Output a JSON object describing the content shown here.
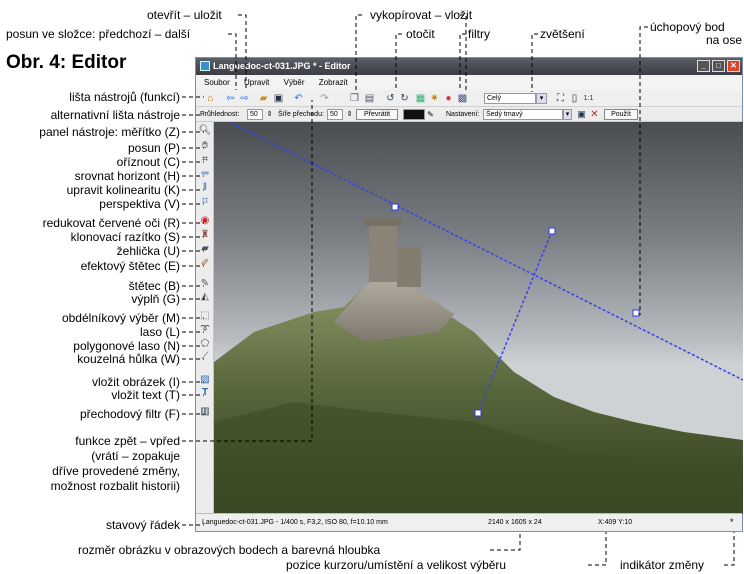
{
  "figure": {
    "title": "Obr. 4: Editor"
  },
  "callouts": {
    "top": {
      "open_save": "otevřít – uložit",
      "back_forward": "posun ve složce: předchozí – další",
      "copy_paste": "vykopírovat – vložit",
      "rotate": "otočit",
      "filters": "filtry",
      "zoom": "zvětšení",
      "handle_point": "úchopový bod",
      "handle_point_2": "na ose"
    },
    "left": {
      "toolbar": "lišta nástrojů (funkcí)",
      "alt_toolbar": "alternativní lišta nástroje",
      "tool_panel": "panel nástroje: měřítko (Z)",
      "pan": "posun (P)",
      "crop": "oříznout (C)",
      "straighten": "srovnat horizont (H)",
      "collinearity": "upravit kolinearitu (K)",
      "perspective": "perspektiva (V)",
      "redeye": "redukovat červené oči (R)",
      "clone": "klonovací razítko (S)",
      "iron": "žehlička (U)",
      "effect_brush": "efektový štětec (E)",
      "brush": "štětec (B)",
      "fill": "výplň (G)",
      "rect_select": "obdélníkový výběr (M)",
      "lasso": "laso (L)",
      "polygon_lasso": "polygonové laso (N)",
      "magic_wand": "kouzelná hůlka (W)",
      "insert_image": "vložit obrázek (I)",
      "insert_text": "vložit text (T)",
      "gradient_filter": "přechodový filtr (F)",
      "undo_redo_1": "funkce zpět – vpřed",
      "undo_redo_2": "(vrátí – zopakuje",
      "undo_redo_3": "dříve provedené změny,",
      "undo_redo_4": "možnost rozbalit historii)",
      "statusbar": "stavový řádek"
    },
    "bottom": {
      "image_size": "rozměr obrázku v obrazových bodech a barevná hloubka",
      "cursor_pos": "pozice kurzoru/umístění a velikost výběru",
      "change_indicator": "indikátor změny"
    }
  },
  "window": {
    "title": "Languedoc-ct-031.JPG * - Editor",
    "menu": [
      "Soubor",
      "Upravit",
      "Výběr",
      "Zobrazit"
    ],
    "toolbar1": {
      "zoom_value": "Celý"
    },
    "toolbar2": {
      "hardness_label": "Průhlednost:",
      "hardness_value": "50",
      "width_label": "Šíře přechodu:",
      "width_value": "50",
      "invert_button": "Převrátit",
      "preset_label": "Nastavení:",
      "preset_value": "Šedý tmavý",
      "apply_button": "Použít"
    },
    "statusbar": {
      "file_info": "Languedoc-ct-031.JPG - 1/400 s, F3,2, ISO 80, f=10.10 mm",
      "image_size": "2140 x 1605 x 24",
      "cursor": "X:409  Y:10",
      "change_indicator": "*"
    }
  },
  "colors": {
    "accent": "#2a2adc",
    "titlebar": "#4a4e55"
  }
}
